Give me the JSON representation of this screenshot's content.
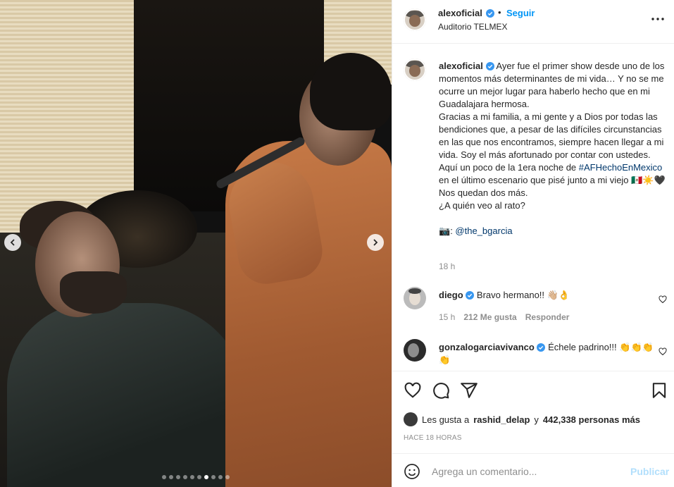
{
  "post": {
    "username": "alexoficial",
    "follow_label": "Seguir",
    "separator": "•",
    "location": "Auditorio TELMEX",
    "photo_count": 10,
    "active_photo_index": 6
  },
  "caption": {
    "username": "alexoficial",
    "line1": "Ayer fue el primer show desde uno de los momentos más determinantes de mi vida… Y no se me ocurre un mejor lugar para haberlo hecho que en mi Guadalajara hermosa.",
    "line2": "Gracias a mi familia, a mi gente y a Dios por todas las bendiciones que, a pesar de las difíciles circunstancias en las que nos encontramos, siempre hacen llegar a mi vida. Soy el más afortunado por contar con ustedes.",
    "line3_pre": "Aquí un poco de la 1era noche de",
    "hashtag": "#AFHechoEnMexico",
    "line3_post": "en el último escenario que pisé junto a mi viejo 🇲🇽☀️🖤 Nos quedan dos más.",
    "line4": "¿A quién veo al rato?",
    "credit_icon": "📷",
    "credit_handle": "@the_bgarcia",
    "time": "18 h"
  },
  "comments": [
    {
      "username": "diego",
      "text": "Bravo hermano!! 👋🏼👌",
      "time": "15 h",
      "likes": "212 Me gusta",
      "reply": "Responder"
    },
    {
      "username": "gonzalogarciavivanco",
      "text": "Échele padrino!!! 👏👏👏 👏"
    }
  ],
  "likes": {
    "prefix": "Les gusta a",
    "user": "rashid_delap",
    "joiner": "y",
    "count": "442,338 personas más"
  },
  "posted_ago": "HACE 18 HORAS",
  "composer": {
    "placeholder": "Agrega un comentario...",
    "publish_label": "Publicar"
  },
  "colors": {
    "link_blue": "#0095f6",
    "hashtag_blue": "#00376b",
    "publish_disabled": "#b2dffc",
    "verified_blue": "#3897f0",
    "secondary_text": "#8e8e8e"
  }
}
